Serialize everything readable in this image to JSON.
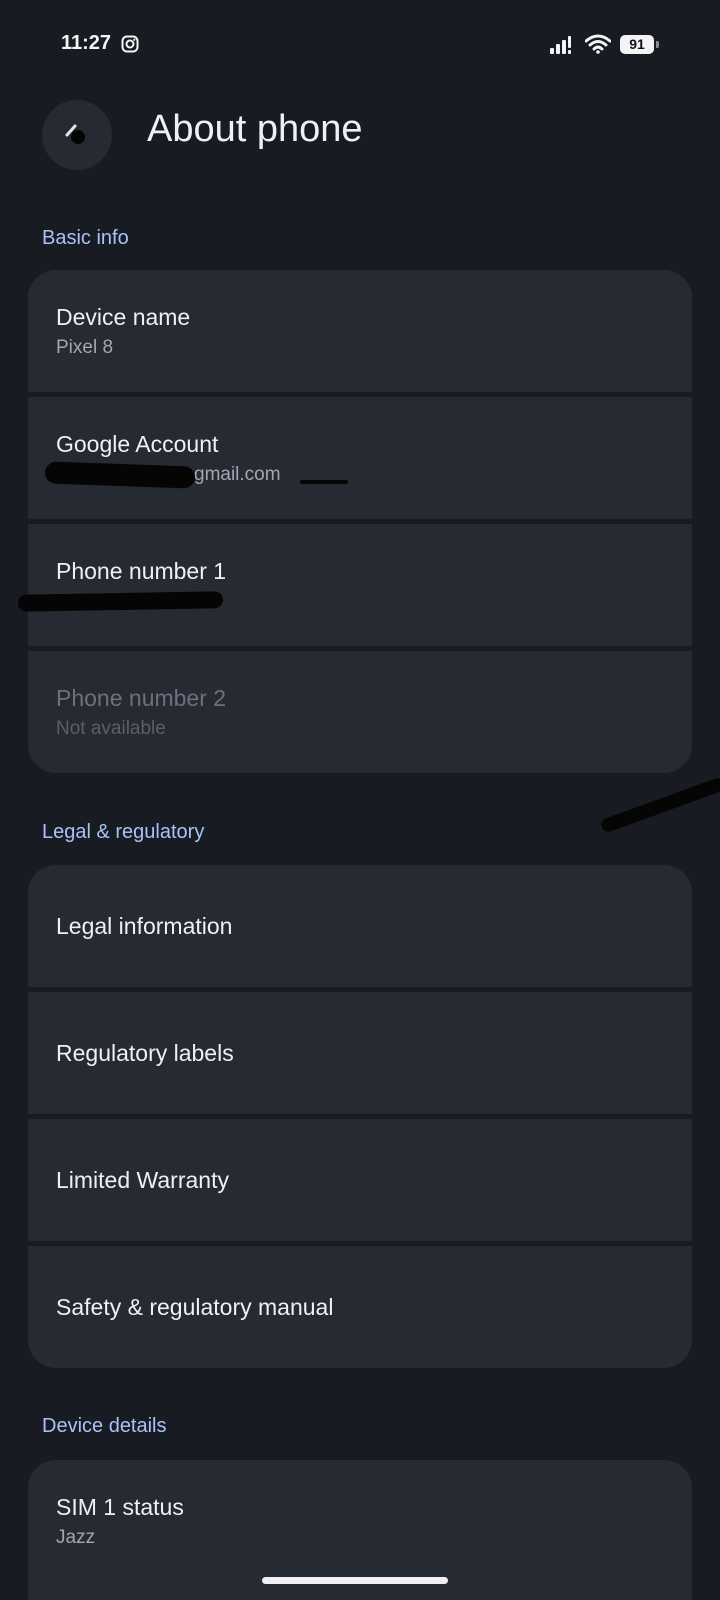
{
  "status_bar": {
    "time": "11:27",
    "battery": "91",
    "icons": [
      "instagram-icon",
      "signal-icon",
      "wifi-icon",
      "battery-icon"
    ]
  },
  "header": {
    "title": "About phone",
    "back_icon": "back-arrow-icon"
  },
  "sections": {
    "basic_info": {
      "title": "Basic info",
      "items": [
        {
          "title": "Device name",
          "subtitle": "Pixel 8"
        },
        {
          "title": "Google Account",
          "subtitle": "gmail.com"
        },
        {
          "title": "Phone number 1",
          "subtitle": ""
        },
        {
          "title": "Phone number 2",
          "subtitle": "Not available"
        }
      ]
    },
    "legal": {
      "title": "Legal & regulatory",
      "items": [
        {
          "title": "Legal information"
        },
        {
          "title": "Regulatory labels"
        },
        {
          "title": "Limited Warranty"
        },
        {
          "title": "Safety & regulatory manual"
        }
      ]
    },
    "device_details": {
      "title": "Device details",
      "items": [
        {
          "title": "SIM 1 status",
          "subtitle": "Jazz"
        }
      ]
    }
  },
  "colors": {
    "background": "#181b22",
    "card": "#262a33",
    "accent": "#a9c3f7"
  }
}
